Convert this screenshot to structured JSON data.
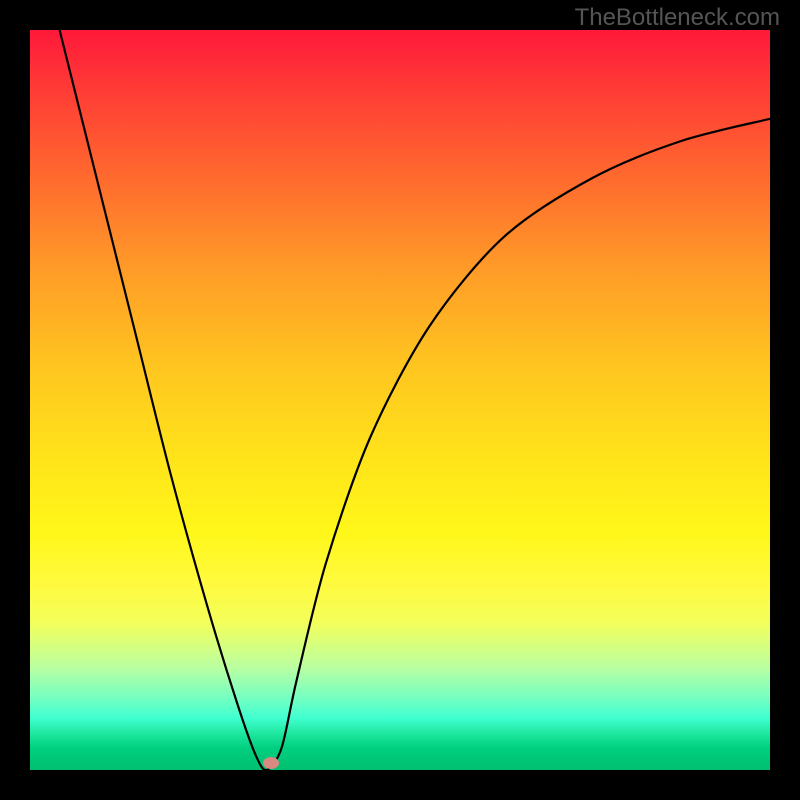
{
  "watermark": "TheBottleneck.com",
  "chart_data": {
    "type": "line",
    "title": "",
    "xlabel": "",
    "ylabel": "",
    "xlim": [
      0,
      100
    ],
    "ylim": [
      0,
      100
    ],
    "grid": false,
    "background_gradient": {
      "direction": "vertical",
      "stops": [
        {
          "pos": 0,
          "color": "#ff193a"
        },
        {
          "pos": 0.5,
          "color": "#ffe41a"
        },
        {
          "pos": 0.95,
          "color": "#20e8a0"
        },
        {
          "pos": 1.0,
          "color": "#00c070"
        }
      ]
    },
    "series": [
      {
        "name": "bottleneck-curve",
        "color": "#000000",
        "points": [
          {
            "x": 4,
            "y": 100
          },
          {
            "x": 9,
            "y": 80
          },
          {
            "x": 14,
            "y": 60
          },
          {
            "x": 19,
            "y": 40
          },
          {
            "x": 24,
            "y": 22
          },
          {
            "x": 28,
            "y": 9
          },
          {
            "x": 30.5,
            "y": 2
          },
          {
            "x": 32,
            "y": 0
          },
          {
            "x": 34,
            "y": 3
          },
          {
            "x": 36,
            "y": 12
          },
          {
            "x": 40,
            "y": 28
          },
          {
            "x": 46,
            "y": 45
          },
          {
            "x": 54,
            "y": 60
          },
          {
            "x": 64,
            "y": 72
          },
          {
            "x": 76,
            "y": 80
          },
          {
            "x": 88,
            "y": 85
          },
          {
            "x": 100,
            "y": 88
          }
        ]
      }
    ],
    "marker": {
      "x": 32.5,
      "y": 1,
      "color": "#d88a80"
    }
  }
}
